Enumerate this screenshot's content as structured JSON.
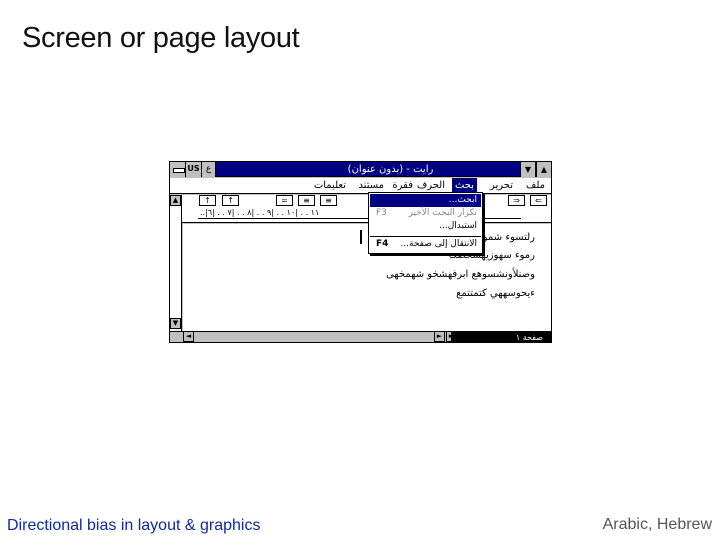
{
  "slide": {
    "title": "Screen or page layout",
    "footer_left": "Directional bias in layout & graphics",
    "footer_right": "Arabic, Hebrew"
  },
  "window": {
    "title": "رايت - (بدون عنوان)",
    "lang_button": "US",
    "lang_button_ar": "ع",
    "min_label": "▼",
    "max_label": "▲"
  },
  "menu": {
    "items": [
      {
        "label": "ملف"
      },
      {
        "label": "تحرير"
      },
      {
        "label": "بحث"
      },
      {
        "label": "الحرف"
      },
      {
        "label": "فقرة"
      },
      {
        "label": "مستند"
      },
      {
        "label": "تعليمات"
      }
    ]
  },
  "dropdown": {
    "items": [
      {
        "label": "ابحث...",
        "key": ""
      },
      {
        "label": "تكرار البحث الأخير",
        "key": "F3"
      },
      {
        "label": "استبدال...",
        "key": ""
      },
      {
        "label": "الانتقال إلى صفحة...",
        "key": "F4"
      }
    ]
  },
  "toolbar": {
    "buttons": [
      "↑",
      "↑",
      "=",
      "≡",
      "≡",
      "⇒",
      "⇐"
    ]
  },
  "ruler": {
    "marks": "..|١١ . . |١٠ . . |٩ . . |٨ . . |٧ . . |٦"
  },
  "document": {
    "lines": [
      "رلتسوء شموک",
      "رموء سهوزيهشحصك",
      "وصنلأونشسوهع ابرفهشخو شهمخهى",
      "ءيحوسههي كتمتتمع"
    ]
  },
  "status": {
    "page_label": "صفحة ١"
  }
}
